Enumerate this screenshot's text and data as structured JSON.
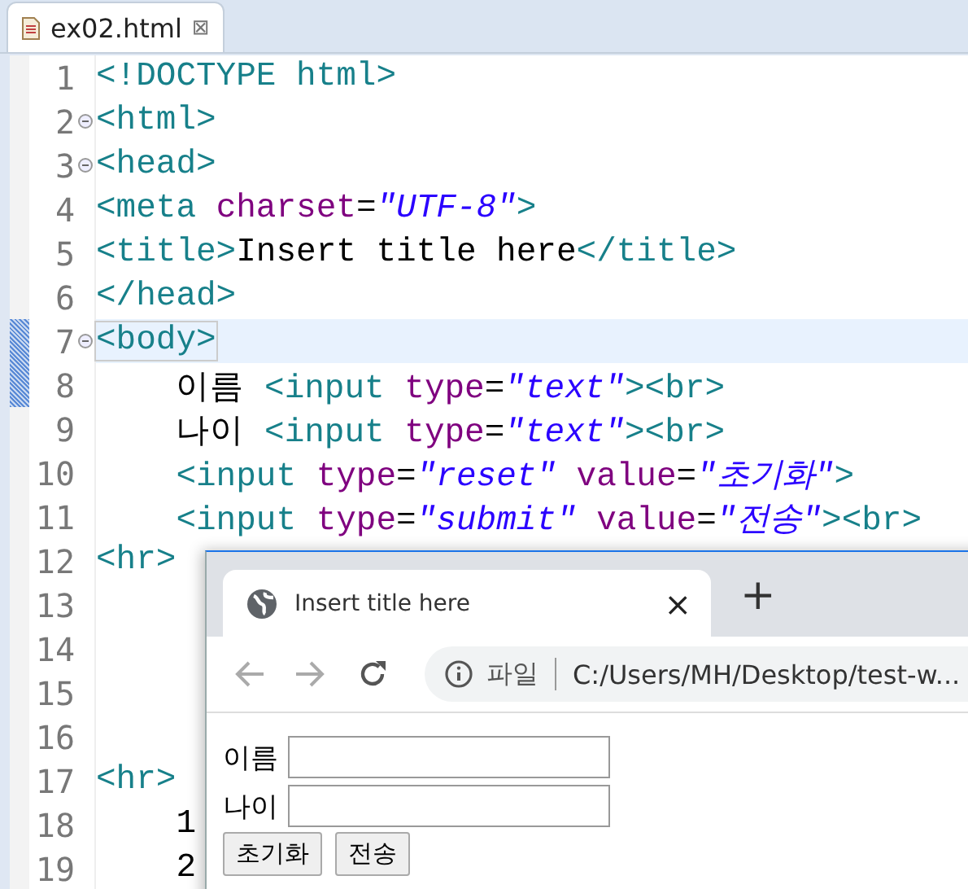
{
  "editor": {
    "tab": {
      "title": "ex02.html",
      "close": "⊠"
    },
    "lines": [
      {
        "number": "1",
        "fold": false,
        "current": false,
        "tokens": [
          {
            "kind": "tag",
            "text": "<!DOCTYPE html>"
          }
        ]
      },
      {
        "number": "2",
        "fold": true,
        "current": false,
        "tokens": [
          {
            "kind": "tag",
            "text": "<html>"
          }
        ]
      },
      {
        "number": "3",
        "fold": true,
        "current": false,
        "tokens": [
          {
            "kind": "tag",
            "text": "<head>"
          }
        ]
      },
      {
        "number": "4",
        "fold": false,
        "current": false,
        "tokens": [
          {
            "kind": "tag",
            "text": "<meta "
          },
          {
            "kind": "attr",
            "text": "charset"
          },
          {
            "kind": "plain",
            "text": "="
          },
          {
            "kind": "string",
            "text": "\"UTF-8\""
          },
          {
            "kind": "tag",
            "text": ">"
          }
        ]
      },
      {
        "number": "5",
        "fold": false,
        "current": false,
        "tokens": [
          {
            "kind": "tag",
            "text": "<title>"
          },
          {
            "kind": "plain",
            "text": "Insert title here"
          },
          {
            "kind": "tag",
            "text": "</title>"
          }
        ]
      },
      {
        "number": "6",
        "fold": false,
        "current": false,
        "tokens": [
          {
            "kind": "tag",
            "text": "</head>"
          }
        ]
      },
      {
        "number": "7",
        "fold": true,
        "current": true,
        "tokens": [
          {
            "kind": "tag",
            "text": "<body>"
          }
        ]
      },
      {
        "number": "8",
        "fold": false,
        "current": false,
        "tokens": [
          {
            "kind": "plain",
            "text": "    이름 "
          },
          {
            "kind": "tag",
            "text": "<input "
          },
          {
            "kind": "attr",
            "text": "type"
          },
          {
            "kind": "plain",
            "text": "="
          },
          {
            "kind": "string",
            "text": "\"text\""
          },
          {
            "kind": "tag",
            "text": "><br>"
          }
        ]
      },
      {
        "number": "9",
        "fold": false,
        "current": false,
        "tokens": [
          {
            "kind": "plain",
            "text": "    나이 "
          },
          {
            "kind": "tag",
            "text": "<input "
          },
          {
            "kind": "attr",
            "text": "type"
          },
          {
            "kind": "plain",
            "text": "="
          },
          {
            "kind": "string",
            "text": "\"text\""
          },
          {
            "kind": "tag",
            "text": "><br>"
          }
        ]
      },
      {
        "number": "10",
        "fold": false,
        "current": false,
        "tokens": [
          {
            "kind": "tag",
            "text": "    <input "
          },
          {
            "kind": "attr",
            "text": "type"
          },
          {
            "kind": "plain",
            "text": "="
          },
          {
            "kind": "string",
            "text": "\"reset\" "
          },
          {
            "kind": "attr",
            "text": "value"
          },
          {
            "kind": "plain",
            "text": "="
          },
          {
            "kind": "string",
            "text": "\"초기화\""
          },
          {
            "kind": "tag",
            "text": ">"
          }
        ]
      },
      {
        "number": "11",
        "fold": false,
        "current": false,
        "tokens": [
          {
            "kind": "tag",
            "text": "    <input "
          },
          {
            "kind": "attr",
            "text": "type"
          },
          {
            "kind": "plain",
            "text": "="
          },
          {
            "kind": "string",
            "text": "\"submit\" "
          },
          {
            "kind": "attr",
            "text": "value"
          },
          {
            "kind": "plain",
            "text": "="
          },
          {
            "kind": "string",
            "text": "\"전송\""
          },
          {
            "kind": "tag",
            "text": "><br>"
          }
        ]
      },
      {
        "number": "12",
        "fold": false,
        "current": false,
        "tokens": [
          {
            "kind": "tag",
            "text": "<hr>"
          }
        ]
      },
      {
        "number": "13",
        "fold": false,
        "current": false
      },
      {
        "number": "14",
        "fold": false,
        "current": false
      },
      {
        "number": "15",
        "fold": false,
        "current": false
      },
      {
        "number": "16",
        "fold": false,
        "current": false
      },
      {
        "number": "17",
        "fold": false,
        "current": false,
        "tokens": [
          {
            "kind": "tag",
            "text": "<hr>"
          }
        ]
      },
      {
        "number": "18",
        "fold": false,
        "current": false,
        "tokens": [
          {
            "kind": "plain",
            "text": "    1"
          }
        ]
      },
      {
        "number": "19",
        "fold": false,
        "current": false,
        "tokens": [
          {
            "kind": "plain",
            "text": "    2"
          }
        ]
      }
    ]
  },
  "browser": {
    "tab": {
      "title": "Insert title here",
      "close": "×"
    },
    "new_tab": "+",
    "address": {
      "scheme": "파일",
      "url": "C:/Users/MH/Desktop/test-w..."
    },
    "form": {
      "fields": [
        {
          "label": "이름"
        },
        {
          "label": "나이"
        }
      ],
      "buttons": [
        "초기화",
        "전송"
      ]
    }
  }
}
